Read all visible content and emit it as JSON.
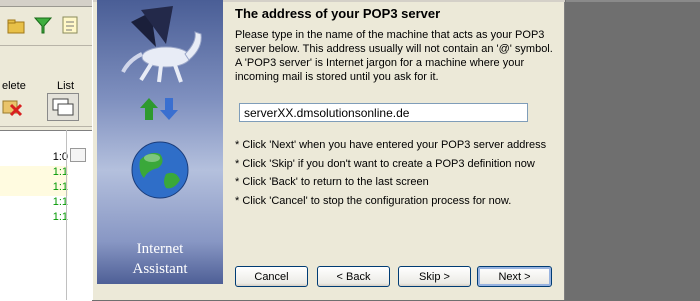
{
  "background_app": {
    "toolbar_labels": {
      "delete": "elete",
      "list": "List"
    },
    "list_rows": [
      "1:0",
      "1:1",
      "1:1",
      "1:1",
      "1:1"
    ]
  },
  "dialog": {
    "sidebar_brand_line1": "Internet",
    "sidebar_brand_line2": "Assistant",
    "heading": "The address of your POP3 server",
    "description": "Please type in the name of the machine that acts as your POP3 server below. This address usually will not contain an '@' symbol. A 'POP3 server' is Internet jargon for a machine where your incoming mail is stored until you ask for it.",
    "server_value": "serverXX.dmsolutionsonline.de",
    "notes": [
      "* Click 'Next' when you have entered your POP3 server address",
      "* Click 'Skip' if you don't want to create a POP3 definition now",
      "* Click 'Back' to return to the last screen",
      "* Click 'Cancel' to stop the configuration process for now."
    ],
    "buttons": {
      "cancel": "Cancel",
      "back": "< Back",
      "skip": "Skip >",
      "next": "Next >"
    }
  },
  "colors": {
    "sidebar_top": "#4a5e96",
    "sidebar_mid": "#b4c0dd",
    "arrow_up": "#2e9a2e",
    "arrow_down": "#3a6fd0",
    "row_green": "#009900"
  }
}
